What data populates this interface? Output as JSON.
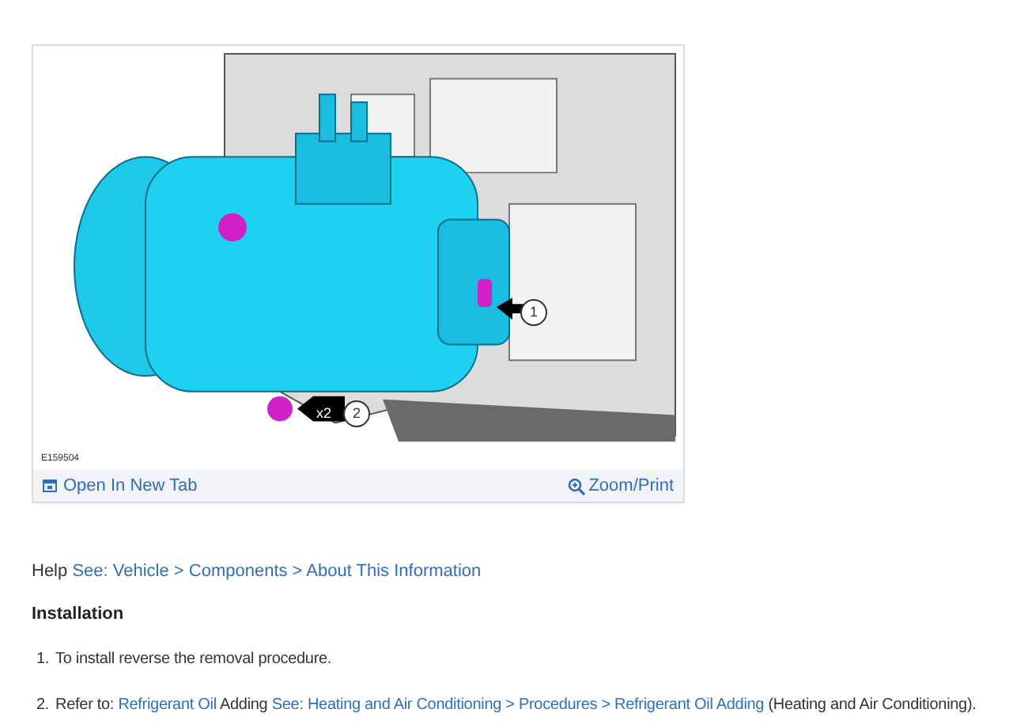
{
  "figure": {
    "callouts": [
      {
        "number": "1"
      },
      {
        "number": "2",
        "multiplier": "x2"
      }
    ],
    "caption": "E159504",
    "open_link": "Open In New Tab",
    "zoom_link": "Zoom/Print"
  },
  "help": {
    "label": "Help",
    "segments": [
      {
        "text": "See: Vehicle > Components > About This Information",
        "link": true
      }
    ]
  },
  "heading": "Installation",
  "steps": [
    {
      "number": "1.",
      "segments": [
        {
          "text": "To install reverse the removal procedure.",
          "link": false
        }
      ]
    },
    {
      "number": "2.",
      "segments": [
        {
          "text": "Refer to:",
          "link": false
        },
        {
          "text": "Refrigerant Oil",
          "link": true
        },
        {
          "text": "Adding",
          "link": false
        },
        {
          "text": "See: Heating and Air Conditioning > Procedures > Refrigerant Oil Adding",
          "link": true
        },
        {
          "text": "(Heating and Air Conditioning).",
          "link": false
        }
      ]
    }
  ]
}
